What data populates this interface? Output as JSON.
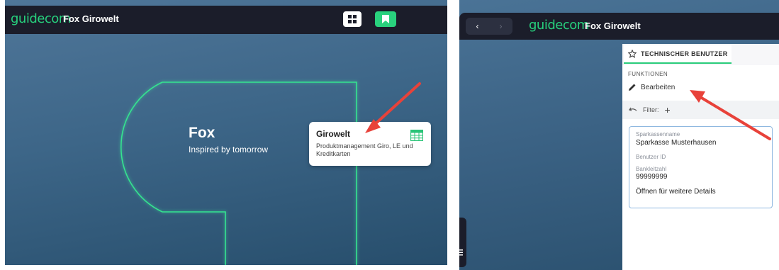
{
  "left": {
    "header": {
      "logo": "guidecom",
      "title": "Fox Girowelt"
    },
    "hero": {
      "title": "Fox",
      "subtitle": "Inspired by tomorrow"
    },
    "card": {
      "title": "Girowelt",
      "description": "Produktmanagement Giro, LE und Kreditkarten"
    },
    "icons": {
      "grid": "grid-icon",
      "bookmark": "bookmark-icon",
      "table": "table-icon"
    },
    "colors": {
      "accent": "#29d17d",
      "topbar": "#1b1d2a",
      "arrow": "#e8423a"
    }
  },
  "right": {
    "header": {
      "logo": "guidecom",
      "title": "Fox Girowelt",
      "back": "‹",
      "forward": "›"
    },
    "tab": {
      "label": "TECHNISCHER BENUTZER"
    },
    "functions": {
      "heading": "FUNKTIONEN",
      "edit_label": "Bearbeiten"
    },
    "filter": {
      "label": "Filter:",
      "add": "+"
    },
    "details": {
      "bank_name_label": "Sparkassenname",
      "bank_name_value": "Sparkasse Musterhausen",
      "user_id_label": "Benutzer ID",
      "blz_label": "Bankleitzahl",
      "blz_value": "99999999",
      "more": "Öffnen für weitere Details"
    }
  }
}
